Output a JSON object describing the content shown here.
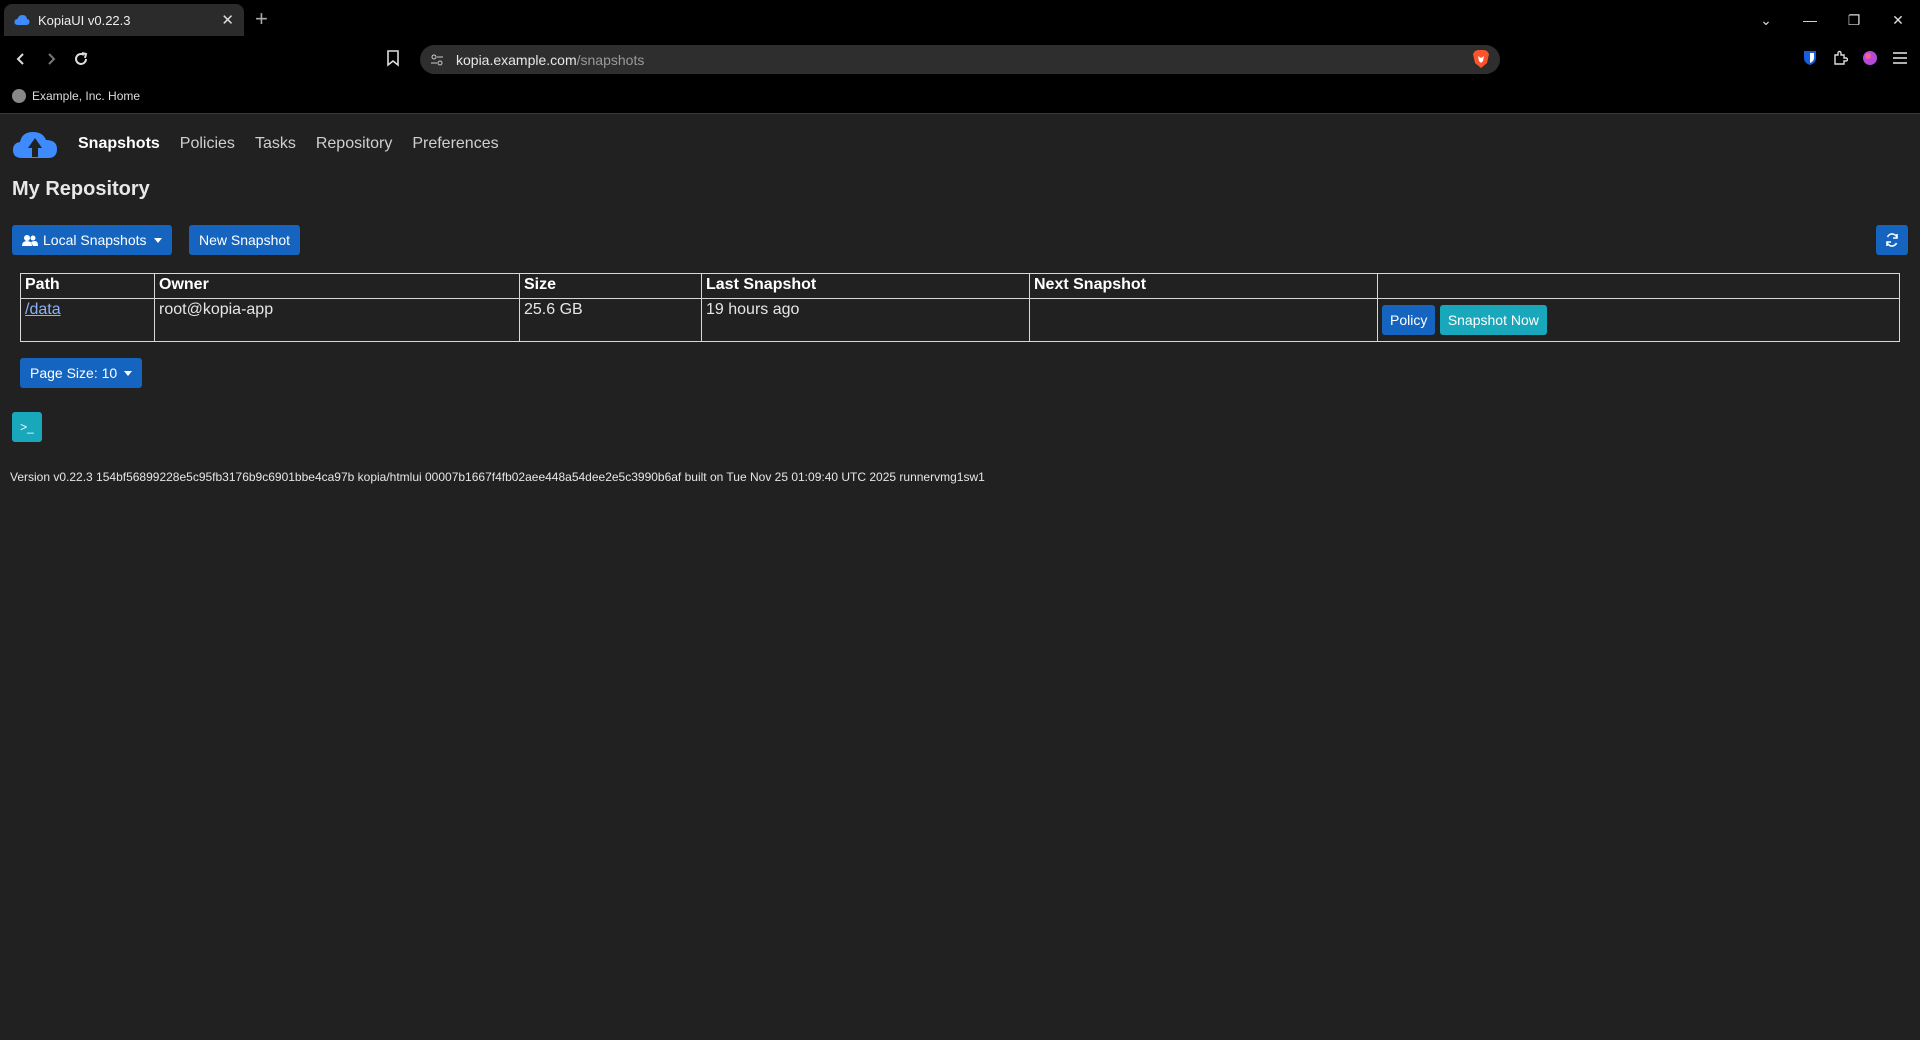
{
  "browser": {
    "tab_title": "KopiaUI v0.22.3",
    "url_host": "kopia.example.com",
    "url_path": "/snapshots",
    "bookmark_label": "Example, Inc. Home"
  },
  "nav": {
    "items": [
      {
        "label": "Snapshots",
        "active": true
      },
      {
        "label": "Policies"
      },
      {
        "label": "Tasks"
      },
      {
        "label": "Repository"
      },
      {
        "label": "Preferences"
      }
    ]
  },
  "page": {
    "title": "My Repository"
  },
  "toolbar": {
    "local_snapshots_label": "Local Snapshots",
    "new_snapshot_label": "New Snapshot"
  },
  "table": {
    "headers": [
      "Path",
      "Owner",
      "Size",
      "Last Snapshot",
      "Next Snapshot",
      ""
    ],
    "rows": [
      {
        "path": "/data",
        "owner": "root@kopia-app",
        "size": "25.6 GB",
        "last_snapshot": "19 hours ago",
        "next_snapshot": "",
        "policy_label": "Policy",
        "snapshot_now_label": "Snapshot Now"
      }
    ]
  },
  "pagination": {
    "page_size_label": "Page Size: 10"
  },
  "footer": {
    "version": "Version v0.22.3 154bf56899228e5c95fb3176b9c6901bbe4ca97b kopia/htmlui 00007b1667f4fb02aee448a54dee2e5c3990b6af built on Tue Nov 25 01:09:40 UTC 2025 runnervmg1sw1"
  },
  "colors": {
    "primary": "#1565c0",
    "info": "#19a7bb",
    "background": "#212121"
  }
}
